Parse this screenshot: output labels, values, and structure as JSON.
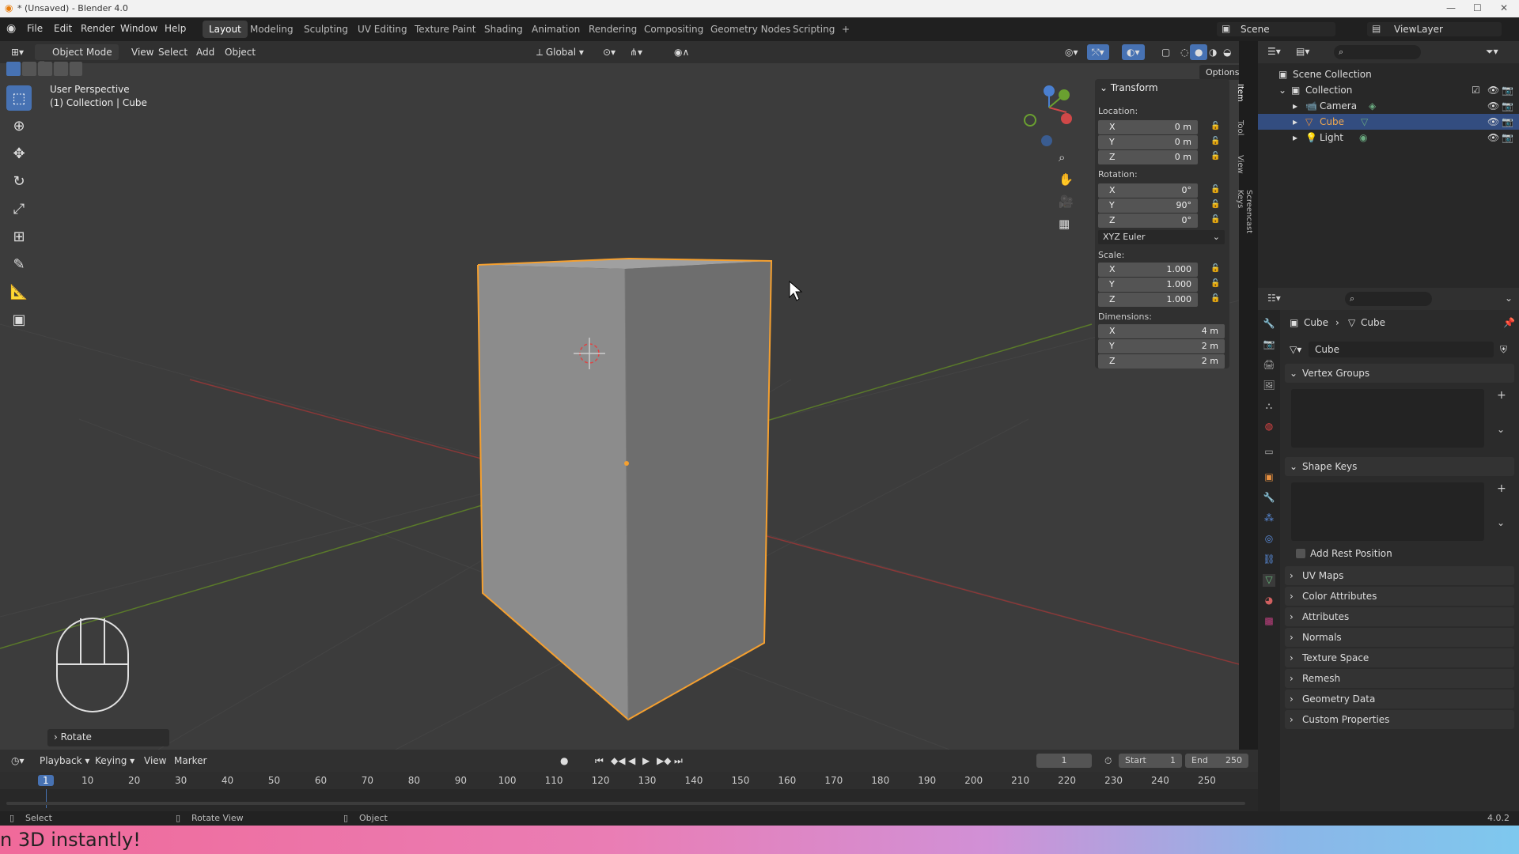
{
  "window": {
    "title": "* (Unsaved) - Blender 4.0"
  },
  "menu": {
    "items": [
      "File",
      "Edit",
      "Render",
      "Window",
      "Help"
    ],
    "workspaces": [
      "Layout",
      "Modeling",
      "Sculpting",
      "UV Editing",
      "Texture Paint",
      "Shading",
      "Animation",
      "Rendering",
      "Compositing",
      "Geometry Nodes",
      "Scripting"
    ],
    "active_workspace": "Layout",
    "scene": "Scene",
    "view_layer": "ViewLayer"
  },
  "header3d": {
    "mode": "Object Mode",
    "menus": [
      "View",
      "Select",
      "Add",
      "Object"
    ],
    "orientation": "Global",
    "options": "Options"
  },
  "viewport": {
    "perspective": "User Perspective",
    "collection": "(1) Collection | Cube",
    "last_op": "Rotate"
  },
  "npanel": {
    "section": "Transform",
    "location_label": "Location:",
    "location": [
      [
        "X",
        "0 m"
      ],
      [
        "Y",
        "0 m"
      ],
      [
        "Z",
        "0 m"
      ]
    ],
    "rotation_label": "Rotation:",
    "rotation": [
      [
        "X",
        "0°"
      ],
      [
        "Y",
        "90°"
      ],
      [
        "Z",
        "0°"
      ]
    ],
    "rotation_mode": "XYZ Euler",
    "scale_label": "Scale:",
    "scale": [
      [
        "X",
        "1.000"
      ],
      [
        "Y",
        "1.000"
      ],
      [
        "Z",
        "1.000"
      ]
    ],
    "dimensions_label": "Dimensions:",
    "dimensions": [
      [
        "X",
        "4 m"
      ],
      [
        "Y",
        "2 m"
      ],
      [
        "Z",
        "2 m"
      ]
    ],
    "tabs": [
      "Item",
      "Tool",
      "View",
      "Screencast Keys"
    ]
  },
  "outliner": {
    "root": "Scene Collection",
    "collection": "Collection",
    "objects": [
      "Camera",
      "Cube",
      "Light"
    ],
    "selected": "Cube"
  },
  "properties": {
    "breadcrumb_object": "Cube",
    "breadcrumb_data": "Cube",
    "mesh_name": "Cube",
    "vertex_groups": "Vertex Groups",
    "shape_keys": "Shape Keys",
    "add_rest_position": "Add Rest Position",
    "panels": [
      "UV Maps",
      "Color Attributes",
      "Attributes",
      "Normals",
      "Texture Space",
      "Remesh",
      "Geometry Data",
      "Custom Properties"
    ]
  },
  "timeline": {
    "menus": [
      "Playback",
      "Keying",
      "View",
      "Marker"
    ],
    "current_frame": "1",
    "start_label": "Start",
    "start": "1",
    "end_label": "End",
    "end": "250",
    "ticks": [
      "1",
      "10",
      "20",
      "30",
      "40",
      "50",
      "60",
      "70",
      "80",
      "90",
      "100",
      "110",
      "120",
      "130",
      "140",
      "150",
      "160",
      "170",
      "180",
      "190",
      "200",
      "210",
      "220",
      "230",
      "240",
      "250"
    ]
  },
  "status": {
    "select": "Select",
    "rotate_view": "Rotate View",
    "object": "Object",
    "version": "4.0.2"
  },
  "banner": {
    "text": "n 3D instantly!"
  },
  "colors": {
    "accent": "#4772b3",
    "selection_outline": "#f5a030",
    "viewport_bg": "#3c3c3c"
  }
}
